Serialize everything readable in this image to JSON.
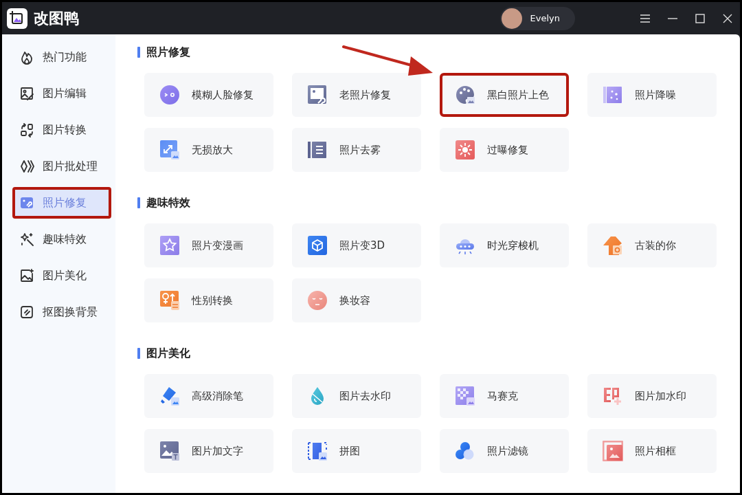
{
  "app": {
    "name": "改图鸭",
    "user": "Evelyn"
  },
  "sidebar": {
    "items": [
      {
        "label": "热门功能",
        "selected": false,
        "highlighted": false
      },
      {
        "label": "图片编辑",
        "selected": false,
        "highlighted": false
      },
      {
        "label": "图片转换",
        "selected": false,
        "highlighted": false
      },
      {
        "label": "图片批处理",
        "selected": false,
        "highlighted": false
      },
      {
        "label": "照片修复",
        "selected": true,
        "highlighted": true
      },
      {
        "label": "趣味特效",
        "selected": false,
        "highlighted": false
      },
      {
        "label": "图片美化",
        "selected": false,
        "highlighted": false
      },
      {
        "label": "抠图换背景",
        "selected": false,
        "highlighted": false
      }
    ]
  },
  "sections": [
    {
      "title": "照片修复",
      "tools": [
        {
          "label": "模糊人脸修复",
          "highlighted": false
        },
        {
          "label": "老照片修复",
          "highlighted": false
        },
        {
          "label": "黑白照片上色",
          "highlighted": true
        },
        {
          "label": "照片降噪",
          "highlighted": false
        },
        {
          "label": "无损放大",
          "highlighted": false
        },
        {
          "label": "照片去雾",
          "highlighted": false
        },
        {
          "label": "过曝修复",
          "highlighted": false
        }
      ]
    },
    {
      "title": "趣味特效",
      "tools": [
        {
          "label": "照片变漫画",
          "highlighted": false
        },
        {
          "label": "照片变3D",
          "highlighted": false
        },
        {
          "label": "时光穿梭机",
          "highlighted": false
        },
        {
          "label": "古装的你",
          "highlighted": false
        },
        {
          "label": "性别转换",
          "highlighted": false
        },
        {
          "label": "换妆容",
          "highlighted": false
        }
      ]
    },
    {
      "title": "图片美化",
      "tools": [
        {
          "label": "高级消除笔",
          "highlighted": false
        },
        {
          "label": "图片去水印",
          "highlighted": false
        },
        {
          "label": "马赛克",
          "highlighted": false
        },
        {
          "label": "图片加水印",
          "highlighted": false
        },
        {
          "label": "图片加文字",
          "highlighted": false
        },
        {
          "label": "拼图",
          "highlighted": false
        },
        {
          "label": "照片滤镜",
          "highlighted": false
        },
        {
          "label": "照片相框",
          "highlighted": false
        }
      ]
    }
  ]
}
